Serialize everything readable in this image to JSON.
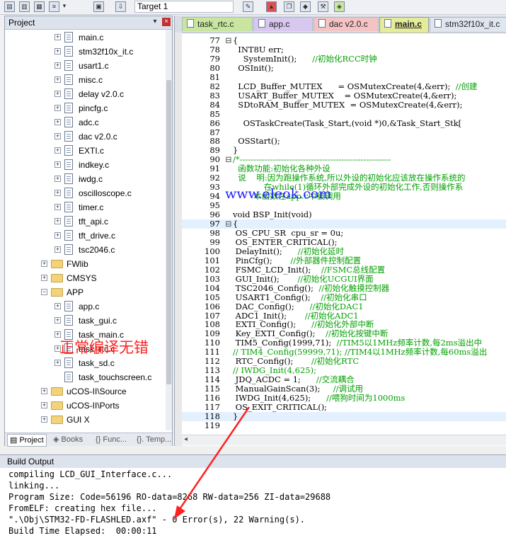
{
  "toolbar": {
    "target_label": "Target 1",
    "target_arrow": "▾"
  },
  "project_panel": {
    "title": "Project",
    "pin": "▾",
    "close": "×",
    "tree": [
      {
        "label": "main.c",
        "kind": "file",
        "indent": 1,
        "expander": "+"
      },
      {
        "label": "stm32f10x_it.c",
        "kind": "file",
        "indent": 1,
        "expander": "+"
      },
      {
        "label": "usart1.c",
        "kind": "file",
        "indent": 1,
        "expander": "+"
      },
      {
        "label": "misc.c",
        "kind": "file",
        "indent": 1,
        "expander": "+"
      },
      {
        "label": "delay v2.0.c",
        "kind": "file",
        "indent": 1,
        "expander": "+"
      },
      {
        "label": "pincfg.c",
        "kind": "file",
        "indent": 1,
        "expander": "+"
      },
      {
        "label": "adc.c",
        "kind": "file",
        "indent": 1,
        "expander": "+"
      },
      {
        "label": "dac v2.0.c",
        "kind": "file",
        "indent": 1,
        "expander": "+"
      },
      {
        "label": "EXTI.c",
        "kind": "file",
        "indent": 1,
        "expander": "+"
      },
      {
        "label": "indkey.c",
        "kind": "file",
        "indent": 1,
        "expander": "+"
      },
      {
        "label": "iwdg.c",
        "kind": "file",
        "indent": 1,
        "expander": "+"
      },
      {
        "label": "oscilloscope.c",
        "kind": "file",
        "indent": 1,
        "expander": "+"
      },
      {
        "label": "timer.c",
        "kind": "file",
        "indent": 1,
        "expander": "+"
      },
      {
        "label": "tft_api.c",
        "kind": "file",
        "indent": 1,
        "expander": "+"
      },
      {
        "label": "tft_drive.c",
        "kind": "file",
        "indent": 1,
        "expander": "+"
      },
      {
        "label": "tsc2046.c",
        "kind": "file",
        "indent": 1,
        "expander": "+"
      },
      {
        "label": "FWlib",
        "kind": "folder",
        "indent": 0,
        "expander": "+"
      },
      {
        "label": "CMSYS",
        "kind": "folder",
        "indent": 0,
        "expander": "+"
      },
      {
        "label": "APP",
        "kind": "folder",
        "indent": 0,
        "expander": "−"
      },
      {
        "label": "app.c",
        "kind": "file",
        "indent": 1,
        "expander": "+"
      },
      {
        "label": "task_gui.c",
        "kind": "file",
        "indent": 1,
        "expander": "+"
      },
      {
        "label": "task_main.c",
        "kind": "file",
        "indent": 1,
        "expander": "+"
      },
      {
        "label": "task_rtc.c",
        "kind": "file",
        "indent": 1,
        "expander": "+"
      },
      {
        "label": "task_sd.c",
        "kind": "file",
        "indent": 1,
        "expander": "+"
      },
      {
        "label": "task_touchscreen.c",
        "kind": "file",
        "indent": 1,
        "expander": ""
      },
      {
        "label": "uCOS-II\\Source",
        "kind": "folder",
        "indent": 0,
        "expander": "+"
      },
      {
        "label": "uCOS-II\\Ports",
        "kind": "folder",
        "indent": 0,
        "expander": "+"
      },
      {
        "label": "GUI X",
        "kind": "folder",
        "indent": 0,
        "expander": "+"
      }
    ],
    "tabs": [
      "Project",
      "Books",
      "{} Func...",
      "{}. Temp..."
    ]
  },
  "editor": {
    "tabs": [
      {
        "label": "task_rtc.c",
        "color": "#c8e6a0",
        "active": false
      },
      {
        "label": "app.c",
        "color": "#d8c8f0",
        "active": false
      },
      {
        "label": "dac v2.0.c",
        "color": "#f4c4c4",
        "active": false
      },
      {
        "label": "main.c",
        "color": "#e4ec9a",
        "active": true
      },
      {
        "label": "stm32f10x_it.c",
        "color": "#dfe6f0",
        "active": false
      }
    ],
    "lines": [
      {
        "n": "77",
        "fold": "⊟",
        "text": "{",
        "cls": ""
      },
      {
        "n": "78",
        "fold": "",
        "text": "  INT8U err;",
        "cls": ""
      },
      {
        "n": "79",
        "fold": "",
        "text": "    SystemInit();      //初始化RCC时钟",
        "cls": ""
      },
      {
        "n": "80",
        "fold": "",
        "text": "  OSInit();",
        "cls": ""
      },
      {
        "n": "81",
        "fold": "",
        "text": "",
        "cls": ""
      },
      {
        "n": "82",
        "fold": "",
        "text": "  LCD_Buffer_MUTEX      = OSMutexCreate(4,&err);  //创建",
        "cls": ""
      },
      {
        "n": "83",
        "fold": "",
        "text": "  USART_Buffer_MUTEX    = OSMutexCreate(4,&err);",
        "cls": ""
      },
      {
        "n": "84",
        "fold": "",
        "text": "  SDtoRAM_Buffer_MUTEX  = OSMutexCreate(4,&err);",
        "cls": ""
      },
      {
        "n": "85",
        "fold": "",
        "text": "",
        "cls": ""
      },
      {
        "n": "86",
        "fold": "",
        "text": "    OSTaskCreate(Task_Start,(void *)0,&Task_Start_Stk[",
        "cls": ""
      },
      {
        "n": "87",
        "fold": "",
        "text": "",
        "cls": ""
      },
      {
        "n": "88",
        "fold": "",
        "text": "  OSStart();",
        "cls": ""
      },
      {
        "n": "89",
        "fold": "",
        "text": "}",
        "cls": ""
      },
      {
        "n": "90",
        "fold": "⊟",
        "text": "/*-------------------------------------------------------",
        "cls": "cmt"
      },
      {
        "n": "91",
        "fold": "",
        "text": "  函数功能:初始化各种外设",
        "cls": "cmt"
      },
      {
        "n": "92",
        "fold": "",
        "text": "  说    明:因为跑操作系统,所以外设的初始化应该放在操作系统的",
        "cls": "cmt"
      },
      {
        "n": "93",
        "fold": "",
        "text": "            在while(1)循环外部完成外设的初始化工作,否则操作系",
        "cls": "cmt"
      },
      {
        "n": "94",
        "fold": "",
        "text": "        本函数在app.c中被调用",
        "cls": "cmt"
      },
      {
        "n": "95",
        "fold": "",
        "text": "",
        "cls": ""
      },
      {
        "n": "96",
        "fold": "",
        "text": "void BSP_Init(void)",
        "cls": ""
      },
      {
        "n": "97",
        "fold": "⊟",
        "text": "{",
        "cls": "hl"
      },
      {
        "n": "98",
        "fold": "",
        "text": " OS_CPU_SR  cpu_sr = 0u;",
        "cls": ""
      },
      {
        "n": "99",
        "fold": "",
        "text": " OS_ENTER_CRITICAL();",
        "cls": ""
      },
      {
        "n": "100",
        "fold": "",
        "text": " DelayInit();      //初始化延时",
        "cls": ""
      },
      {
        "n": "101",
        "fold": "",
        "text": " PinCfg();       //外部器件控制配置",
        "cls": ""
      },
      {
        "n": "102",
        "fold": "",
        "text": " FSMC_LCD_Init();    //FSMC总线配置",
        "cls": ""
      },
      {
        "n": "103",
        "fold": "",
        "text": " GUI_Init();       //初始化UCGUI界面",
        "cls": ""
      },
      {
        "n": "104",
        "fold": "",
        "text": " TSC2046_Config();  //初始化触摸控制器",
        "cls": ""
      },
      {
        "n": "105",
        "fold": "",
        "text": " USART1_Config();    //初始化串口",
        "cls": ""
      },
      {
        "n": "106",
        "fold": "",
        "text": " DAC_Config();      //初始化DAC1",
        "cls": ""
      },
      {
        "n": "107",
        "fold": "",
        "text": " ADC1_Init();       //初始化ADC1",
        "cls": ""
      },
      {
        "n": "108",
        "fold": "",
        "text": " EXTI_Config();      //初始化外部中断",
        "cls": ""
      },
      {
        "n": "109",
        "fold": "",
        "text": " Key_EXTI_Config();    //初始化按键中断",
        "cls": ""
      },
      {
        "n": "110",
        "fold": "",
        "text": " TIM5_Config(1999,71);  //TIM5以1MHz频率计数,每2ms溢出中",
        "cls": ""
      },
      {
        "n": "111",
        "fold": "",
        "text": "// TIM4_Config(59999,71); //TIM4以1MHz频率计数,每60ms溢出",
        "cls": "cmt"
      },
      {
        "n": "112",
        "fold": "",
        "text": " RTC_Config();       //初始化RTC",
        "cls": ""
      },
      {
        "n": "113",
        "fold": "",
        "text": "// IWDG_Init(4,625);",
        "cls": "cmt"
      },
      {
        "n": "114",
        "fold": "",
        "text": " JDQ_ACDC = 1;      //交流耦合",
        "cls": ""
      },
      {
        "n": "115",
        "fold": "",
        "text": " ManualGainScan(3);     //调试用",
        "cls": ""
      },
      {
        "n": "116",
        "fold": "",
        "text": " IWDG_Init(4,625);      //喂狗时间为1000ms",
        "cls": ""
      },
      {
        "n": "117",
        "fold": "",
        "text": " OS_EXIT_CRITICAL();",
        "cls": ""
      },
      {
        "n": "118",
        "fold": "",
        "text": "}",
        "cls": "hl"
      },
      {
        "n": "119",
        "fold": "",
        "text": "",
        "cls": ""
      }
    ],
    "watermark": "www.eleok.com",
    "annotation": "正常编译无错"
  },
  "build_output": {
    "title": "Build Output",
    "lines": [
      "compiling LCD_GUI_Interface.c...",
      "linking...",
      "Program Size: Code=56196 RO-data=8268 RW-data=256 ZI-data=29688",
      "FromELF: creating hex file...",
      "\".\\Obj\\STM32-FD-FLASHLED.axf\" - 0 Error(s), 22 Warning(s).",
      "Build Time Elapsed:  00:00:11"
    ]
  },
  "colors": {
    "comment": "#00a000",
    "annotation": "#ff2020",
    "watermark": "#2020ff"
  },
  "icons": [
    "save-icon",
    "save-all-icon",
    "load-icon",
    "stack-icon",
    "dropdown-icon",
    "translate-icon",
    "download-icon",
    "wand-icon",
    "manage-icon",
    "copy-icon",
    "diamond-icon",
    "hammer-icon",
    "puzzle-icon"
  ]
}
